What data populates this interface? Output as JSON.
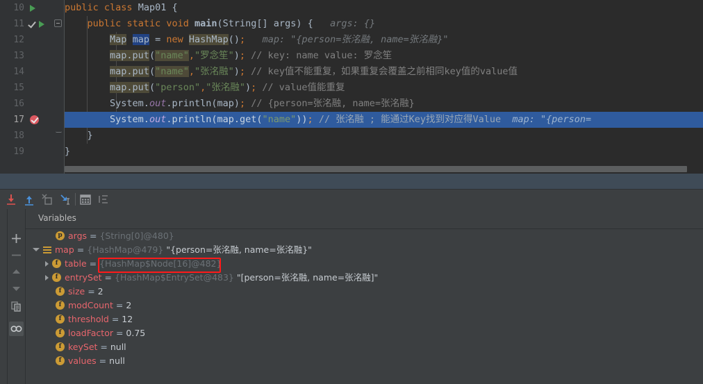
{
  "editor": {
    "lines": [
      {
        "num": "10",
        "gutter": [
          "run-arrow-icon"
        ],
        "fold": "none",
        "tokens": [
          {
            "t": "public",
            "c": "kw"
          },
          {
            "t": " ",
            "c": "plain"
          },
          {
            "t": "class",
            "c": "kw"
          },
          {
            "t": " ",
            "c": "plain"
          },
          {
            "t": "Map01",
            "c": "cls"
          },
          {
            "t": " {",
            "c": "plain"
          }
        ]
      },
      {
        "num": "11",
        "gutter": [
          "check-icon",
          "run-arrow-icon"
        ],
        "fold": "collapse",
        "tokens": [
          {
            "t": "    ",
            "c": "plain"
          },
          {
            "t": "public",
            "c": "kw"
          },
          {
            "t": " ",
            "c": "plain"
          },
          {
            "t": "static",
            "c": "kw"
          },
          {
            "t": " ",
            "c": "plain"
          },
          {
            "t": "void",
            "c": "kw"
          },
          {
            "t": " ",
            "c": "plain"
          },
          {
            "t": "main",
            "c": "bold-plain"
          },
          {
            "t": "(String[] args) {",
            "c": "plain"
          },
          {
            "t": "   args: {}",
            "c": "hint"
          }
        ]
      },
      {
        "num": "12",
        "gutter": [],
        "fold": "none",
        "tokens": [
          {
            "t": "        ",
            "c": "plain"
          },
          {
            "t": "Map",
            "c": "hl-ident"
          },
          {
            "t": " ",
            "c": "plain"
          },
          {
            "t": "map",
            "c": "hl-dark"
          },
          {
            "t": " = ",
            "c": "plain"
          },
          {
            "t": "new",
            "c": "kw"
          },
          {
            "t": " ",
            "c": "plain"
          },
          {
            "t": "HashMap",
            "c": "hl-ident"
          },
          {
            "t": "()",
            "c": "plain"
          },
          {
            "t": ";",
            "c": "semi"
          },
          {
            "t": "   map: \"{person=张洺融, name=张洺融}\"",
            "c": "hint"
          }
        ]
      },
      {
        "num": "13",
        "gutter": [],
        "fold": "none",
        "tokens": [
          {
            "t": "        ",
            "c": "plain"
          },
          {
            "t": "map.put",
            "c": "hl-ident"
          },
          {
            "t": "(",
            "c": "plain"
          },
          {
            "t": "\"name\"",
            "c": "hl-str"
          },
          {
            "t": ",",
            "c": "semi"
          },
          {
            "t": "\"罗念笙\"",
            "c": "str"
          },
          {
            "t": ")",
            "c": "plain"
          },
          {
            "t": ";",
            "c": "semi"
          },
          {
            "t": " // key: name value: 罗念笙",
            "c": "cmt"
          }
        ]
      },
      {
        "num": "14",
        "gutter": [],
        "fold": "none",
        "tokens": [
          {
            "t": "        ",
            "c": "plain"
          },
          {
            "t": "map.put",
            "c": "hl-ident"
          },
          {
            "t": "(",
            "c": "plain"
          },
          {
            "t": "\"name\"",
            "c": "hl-str"
          },
          {
            "t": ",",
            "c": "semi"
          },
          {
            "t": "\"张洺融\"",
            "c": "str"
          },
          {
            "t": ")",
            "c": "plain"
          },
          {
            "t": ";",
            "c": "semi"
          },
          {
            "t": " // key值不能重复，如果重复会覆盖之前相同key值的value值",
            "c": "cmt"
          }
        ]
      },
      {
        "num": "15",
        "gutter": [],
        "fold": "none",
        "tokens": [
          {
            "t": "        ",
            "c": "plain"
          },
          {
            "t": "map.put",
            "c": "hl-ident"
          },
          {
            "t": "(",
            "c": "plain"
          },
          {
            "t": "\"person\"",
            "c": "str"
          },
          {
            "t": ",",
            "c": "semi"
          },
          {
            "t": "\"张洺融\"",
            "c": "str"
          },
          {
            "t": ")",
            "c": "plain"
          },
          {
            "t": ";",
            "c": "semi"
          },
          {
            "t": " // value值能重复",
            "c": "cmt"
          }
        ]
      },
      {
        "num": "16",
        "gutter": [],
        "fold": "none",
        "tokens": [
          {
            "t": "        ",
            "c": "plain"
          },
          {
            "t": "System.",
            "c": "plain"
          },
          {
            "t": "out",
            "c": "fld"
          },
          {
            "t": ".println(map)",
            "c": "plain"
          },
          {
            "t": ";",
            "c": "semi"
          },
          {
            "t": " // {person=张洺融, name=张洺融}",
            "c": "cmt"
          }
        ]
      },
      {
        "num": "17",
        "gutter": [
          "breakpoint-icon"
        ],
        "fold": "none",
        "current": true,
        "tokens": [
          {
            "t": "        ",
            "c": "plain"
          },
          {
            "t": "System.",
            "c": "cur-txt"
          },
          {
            "t": "out",
            "c": "cur-fld"
          },
          {
            "t": ".println(map.get(",
            "c": "cur-txt"
          },
          {
            "t": "\"name\"",
            "c": "cur-str"
          },
          {
            "t": "))",
            "c": "cur-txt"
          },
          {
            "t": ";",
            "c": "cur-semi"
          },
          {
            "t": " // 张洺融 ; 能通过Key找到对应得Value",
            "c": "cur-cmt"
          },
          {
            "t": "  map: \"{person=",
            "c": "hint-cur"
          }
        ]
      },
      {
        "num": "18",
        "gutter": [],
        "fold": "tail",
        "tokens": [
          {
            "t": "    }",
            "c": "plain"
          }
        ]
      },
      {
        "num": "19",
        "gutter": [],
        "fold": "none",
        "tokens": [
          {
            "t": "}",
            "c": "plain"
          }
        ]
      }
    ]
  },
  "debug_toolbar": {
    "buttons": [
      {
        "name": "step-over-icon",
        "label": "Step Over"
      },
      {
        "name": "step-out-icon",
        "label": "Step Out"
      },
      {
        "name": "force-step-into-icon",
        "label": "Force Step Into"
      },
      {
        "name": "run-to-cursor-icon",
        "label": "Run to Cursor"
      },
      {
        "name": "evaluate-expression-icon",
        "label": "Evaluate Expression"
      },
      {
        "name": "show-frames-icon",
        "label": "Show Execution Point"
      }
    ]
  },
  "variables_panel": {
    "header": "Variables",
    "side_buttons": [
      {
        "name": "add-watch-button",
        "glyph": "+"
      },
      {
        "name": "remove-watch-button",
        "glyph": "−"
      },
      {
        "name": "move-up-button",
        "glyph": "up"
      },
      {
        "name": "move-down-button",
        "glyph": "down"
      },
      {
        "name": "copy-value-button",
        "glyph": "copy"
      },
      {
        "name": "inspect-watches-button",
        "glyph": "glasses"
      }
    ],
    "rows": [
      {
        "indent": 1,
        "expander": "none",
        "icon": "p",
        "icon_kind": "param",
        "name": "args",
        "eq": " = ",
        "ref": "{String[0]@480}",
        "value": ""
      },
      {
        "indent": 0,
        "expander": "open",
        "icon": "",
        "icon_kind": "local",
        "name": "map",
        "eq": " = ",
        "ref": "{HashMap@479}",
        "value": "\"{person=张洺融, name=张洺融}\""
      },
      {
        "indent": 1,
        "expander": "closed",
        "icon": "f",
        "icon_kind": "field",
        "name": "table",
        "eq": " = ",
        "ref": "{HashMap$Node[16]@482}",
        "value": "",
        "annotated": true
      },
      {
        "indent": 1,
        "expander": "closed",
        "icon": "f",
        "icon_kind": "field",
        "name": "entrySet",
        "eq": " = ",
        "ref": "{HashMap$EntrySet@483}",
        "value": "\"[person=张洺融, name=张洺融]\""
      },
      {
        "indent": 1,
        "expander": "none",
        "icon": "f",
        "icon_kind": "field",
        "name": "size",
        "eq": " = ",
        "ref": "",
        "value": "2"
      },
      {
        "indent": 1,
        "expander": "none",
        "icon": "f",
        "icon_kind": "field",
        "name": "modCount",
        "eq": " = ",
        "ref": "",
        "value": "2"
      },
      {
        "indent": 1,
        "expander": "none",
        "icon": "f",
        "icon_kind": "field",
        "name": "threshold",
        "eq": " = ",
        "ref": "",
        "value": "12"
      },
      {
        "indent": 1,
        "expander": "none",
        "icon": "f",
        "icon_kind": "field",
        "name": "loadFactor",
        "eq": " = ",
        "ref": "",
        "value": "0.75"
      },
      {
        "indent": 1,
        "expander": "none",
        "icon": "f",
        "icon_kind": "field",
        "name": "keySet",
        "eq": " = ",
        "ref": "",
        "value": "null"
      },
      {
        "indent": 1,
        "expander": "none",
        "icon": "f",
        "icon_kind": "field",
        "name": "values",
        "eq": " = ",
        "ref": "",
        "value": "null"
      }
    ]
  },
  "colors": {
    "editor_bg": "#2b2b2b",
    "gutter_bg": "#313335",
    "panel_bg": "#3c3f41",
    "current_line": "#2f5b9e",
    "keyword": "#cc7832",
    "string": "#6a8759",
    "comment": "#808080",
    "var_name": "#e8666d",
    "annotation": "#ff1a1a",
    "breakpoint": "#db5860",
    "run_arrow": "#499c54"
  }
}
